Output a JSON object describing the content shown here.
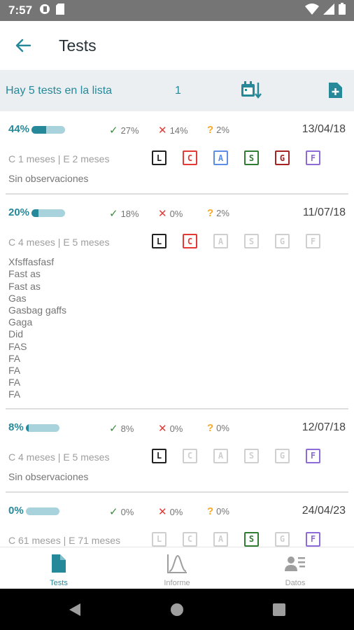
{
  "status_bar": {
    "time": "7:57"
  },
  "app_bar": {
    "title": "Tests",
    "back_icon": "arrow-back-icon"
  },
  "summary": {
    "text": "Hay 5 tests en la lista",
    "count": "1",
    "sort_icon": "calendar-sort-icon",
    "add_icon": "add-file-icon"
  },
  "colors": {
    "accent": "#26899a",
    "correct": "#388e3c",
    "wrong": "#e53935",
    "unknown": "#f9a825",
    "summary_bg": "#eceff1"
  },
  "tests": [
    {
      "percent": "44%",
      "progress": 0.44,
      "correct": "27%",
      "wrong": "14%",
      "unknown": "2%",
      "date": "13/04/18",
      "ages": "C 1 meses | E 2 meses",
      "labels": [
        {
          "t": "L",
          "c": "#212121"
        },
        {
          "t": "C",
          "c": "#e53935"
        },
        {
          "t": "A",
          "c": "#5c8ee6"
        },
        {
          "t": "S",
          "c": "#2e7d32"
        },
        {
          "t": "G",
          "c": "#a52323"
        },
        {
          "t": "F",
          "c": "#8e6bd6"
        }
      ],
      "observations": [
        "Sin observaciones"
      ]
    },
    {
      "percent": "20%",
      "progress": 0.2,
      "correct": "18%",
      "wrong": "0%",
      "unknown": "2%",
      "date": "11/07/18",
      "ages": "C 4 meses | E 5 meses",
      "labels": [
        {
          "t": "L",
          "c": "#212121"
        },
        {
          "t": "C",
          "c": "#e53935"
        },
        {
          "t": "A",
          "c": "#cfcfcf"
        },
        {
          "t": "S",
          "c": "#cfcfcf"
        },
        {
          "t": "G",
          "c": "#cfcfcf"
        },
        {
          "t": "F",
          "c": "#cfcfcf"
        }
      ],
      "observations": [
        "Xfsffasfasf",
        "Fast as",
        "Fast as",
        "Gas",
        "Gasbag gaffs",
        "Gaga",
        "Did",
        "FAS",
        "FA",
        "FA",
        "FA",
        "FA"
      ]
    },
    {
      "percent": "8%",
      "progress": 0.08,
      "correct": "8%",
      "wrong": "0%",
      "unknown": "0%",
      "date": "12/07/18",
      "ages": "C 4 meses | E 5 meses",
      "labels": [
        {
          "t": "L",
          "c": "#212121"
        },
        {
          "t": "C",
          "c": "#cfcfcf"
        },
        {
          "t": "A",
          "c": "#cfcfcf"
        },
        {
          "t": "S",
          "c": "#cfcfcf"
        },
        {
          "t": "G",
          "c": "#cfcfcf"
        },
        {
          "t": "F",
          "c": "#8e6bd6"
        }
      ],
      "observations": [
        "Sin observaciones"
      ]
    },
    {
      "percent": "0%",
      "progress": 0.0,
      "correct": "0%",
      "wrong": "0%",
      "unknown": "0%",
      "date": "24/04/23",
      "ages": "C 61 meses | E 71 meses",
      "labels": [
        {
          "t": "L",
          "c": "#cfcfcf"
        },
        {
          "t": "C",
          "c": "#cfcfcf"
        },
        {
          "t": "A",
          "c": "#cfcfcf"
        },
        {
          "t": "S",
          "c": "#2e7d32"
        },
        {
          "t": "G",
          "c": "#cfcfcf"
        },
        {
          "t": "F",
          "c": "#8e6bd6"
        }
      ],
      "observations": []
    }
  ],
  "bottom_nav": [
    {
      "label": "Tests",
      "icon": "document-icon",
      "active": true
    },
    {
      "label": "Informe",
      "icon": "chart-curve-icon",
      "active": false
    },
    {
      "label": "Datos",
      "icon": "person-list-icon",
      "active": false
    }
  ]
}
